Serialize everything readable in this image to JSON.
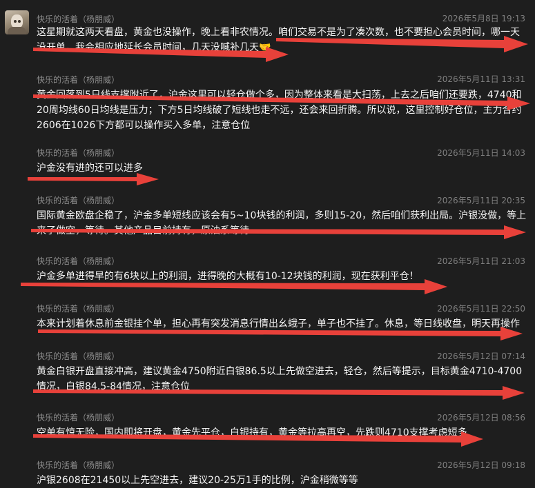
{
  "messages": [
    {
      "sender": "快乐的活着（杨朋威）",
      "time": "2026年5月8日 19:13",
      "text": "这星期就这两天看盘，黄金也没操作，晚上看非农情况。咱们交易不是为了凑次数，也不要担心会员时间，哪一天没开单，我会相应地延长会员时间，几天没喊补几天🤝"
    },
    {
      "sender": "快乐的活着（杨朋威）",
      "time": "2026年5月11日 13:31",
      "text": "黄金回落到5日线支撑附近了，沪金这里可以轻仓做个多，因为整体来看是大扫荡，上去之后咱们还要跌，4740和20周均线60日均线是压力；下方5日均线破了短线也走不远，还会来回折腾。所以说，这里控制好仓位，主力合约2606在1026下方都可以操作买入多单，注意仓位"
    },
    {
      "sender": "快乐的活着（杨朋威）",
      "time": "2026年5月11日 14:03",
      "text": "沪金没有进的还可以进多"
    },
    {
      "sender": "快乐的活着（杨朋威）",
      "time": "2026年5月11日 20:35",
      "text": "国际黄金欧盘企稳了，沪金多单短线应该会有5~10块钱的利润，多则15-20，然后咱们获利出局。沪银没做，等上来了做空，等待。其他产品目前持有，原油系等待"
    },
    {
      "sender": "快乐的活着（杨朋威）",
      "time": "2026年5月11日 21:03",
      "text": "沪金多单进得早的有6块以上的利润，进得晚的大概有10-12块钱的利润，现在获利平仓！"
    },
    {
      "sender": "快乐的活着（杨朋威）",
      "time": "2026年5月11日 22:50",
      "text": "本来计划着休息前金银挂个单，担心再有突发消息行情出幺蛾子，单子也不挂了。休息，等日线收盘，明天再操作"
    },
    {
      "sender": "快乐的活着（杨朋威）",
      "time": "2026年5月12日 07:14",
      "text": "黄金白银开盘直接冲高，建议黄金4750附近白银86.5以上先做空进去，轻仓，然后等提示，目标黄金4710-4700情况，白银84.5-84情况，注意仓位"
    },
    {
      "sender": "快乐的活着（杨朋威）",
      "time": "2026年5月12日 08:56",
      "text": "空单有惊无险，国内即将开盘，黄金先平仓，白银持有，黄金等拉高再空，先跌则4710支撑考虑短多"
    },
    {
      "sender": "快乐的活着（杨朋威）",
      "time": "2026年5月12日 09:18",
      "text": "沪银2608在21450以上先空进去，建议20-25万1手的比例，沪金稍微等等"
    }
  ],
  "colors": {
    "background": "#1e1e1e",
    "meta_text": "#8c8c8c",
    "body_text": "#f4f4f4",
    "arrow": "#e8413a"
  }
}
